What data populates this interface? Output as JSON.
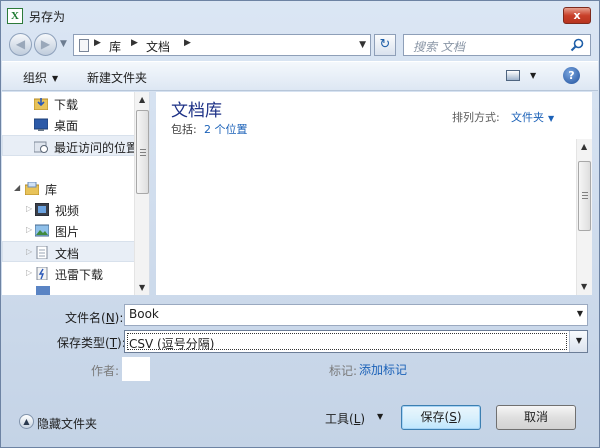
{
  "window": {
    "title": "另存为",
    "app_icon": "X",
    "close": "x"
  },
  "address_bar": {
    "crumbs": [
      "库",
      "文档"
    ],
    "search_placeholder": "搜索 文档"
  },
  "toolbar": {
    "organize": "组织",
    "new_folder": "新建文件夹",
    "help": "?"
  },
  "nav_pane": {
    "items": [
      {
        "label": "下载",
        "icon": "download-folder-icon"
      },
      {
        "label": "桌面",
        "icon": "desktop-icon"
      },
      {
        "label": "最近访问的位置",
        "icon": "recent-places-icon"
      },
      {
        "label": "库",
        "icon": "libraries-icon"
      },
      {
        "label": "视频",
        "icon": "video-library-icon"
      },
      {
        "label": "图片",
        "icon": "pictures-library-icon"
      },
      {
        "label": "文档",
        "icon": "documents-library-icon"
      },
      {
        "label": "迅雷下载",
        "icon": "thunder-download-icon"
      }
    ]
  },
  "file_pane": {
    "library_title": "文档库",
    "includes_label": "包括:",
    "includes_link": "2 个位置",
    "arrange_label": "排列方式:",
    "arrange_value": "文件夹"
  },
  "form": {
    "filename_label": "文件名(",
    "filename_key": "N",
    "filename_suffix": "):",
    "filename_value": "Book",
    "savetype_label": "保存类型(",
    "savetype_key": "T",
    "savetype_suffix": "):",
    "savetype_value": "CSV (逗号分隔)",
    "author_label": "作者:",
    "tags_label": "标记:",
    "tags_link": "添加标记"
  },
  "footer": {
    "hide_folders": "隐藏文件夹",
    "tools_label": "工具(",
    "tools_key": "L",
    "tools_suffix": ")",
    "save_label": "保存(",
    "save_key": "S",
    "save_suffix": ")",
    "cancel_label": "取消"
  },
  "colors": {
    "link": "#1c62b8",
    "library_title": "#1e3287",
    "close_button": "#c9402a"
  }
}
